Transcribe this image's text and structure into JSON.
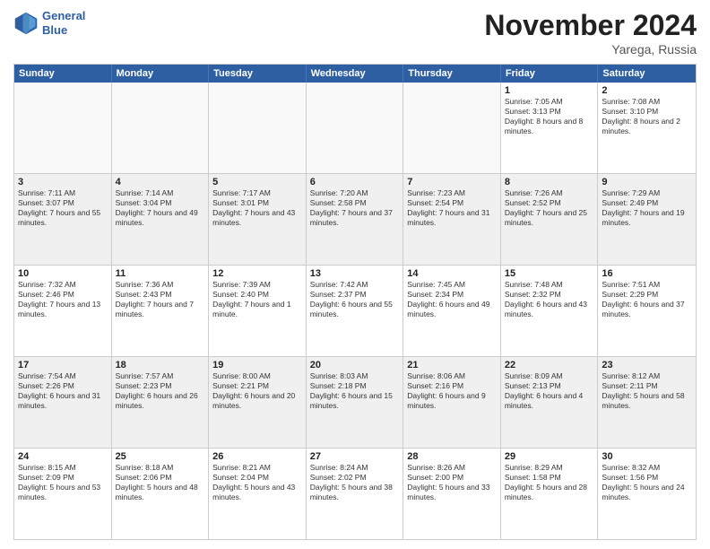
{
  "header": {
    "logo_line1": "General",
    "logo_line2": "Blue",
    "month_title": "November 2024",
    "location": "Yarega, Russia"
  },
  "days_of_week": [
    "Sunday",
    "Monday",
    "Tuesday",
    "Wednesday",
    "Thursday",
    "Friday",
    "Saturday"
  ],
  "weeks": [
    [
      {
        "day": "",
        "empty": true
      },
      {
        "day": "",
        "empty": true
      },
      {
        "day": "",
        "empty": true
      },
      {
        "day": "",
        "empty": true
      },
      {
        "day": "",
        "empty": true
      },
      {
        "day": "1",
        "sunrise": "Sunrise: 7:05 AM",
        "sunset": "Sunset: 3:13 PM",
        "daylight": "Daylight: 8 hours and 8 minutes."
      },
      {
        "day": "2",
        "sunrise": "Sunrise: 7:08 AM",
        "sunset": "Sunset: 3:10 PM",
        "daylight": "Daylight: 8 hours and 2 minutes."
      }
    ],
    [
      {
        "day": "3",
        "sunrise": "Sunrise: 7:11 AM",
        "sunset": "Sunset: 3:07 PM",
        "daylight": "Daylight: 7 hours and 55 minutes."
      },
      {
        "day": "4",
        "sunrise": "Sunrise: 7:14 AM",
        "sunset": "Sunset: 3:04 PM",
        "daylight": "Daylight: 7 hours and 49 minutes."
      },
      {
        "day": "5",
        "sunrise": "Sunrise: 7:17 AM",
        "sunset": "Sunset: 3:01 PM",
        "daylight": "Daylight: 7 hours and 43 minutes."
      },
      {
        "day": "6",
        "sunrise": "Sunrise: 7:20 AM",
        "sunset": "Sunset: 2:58 PM",
        "daylight": "Daylight: 7 hours and 37 minutes."
      },
      {
        "day": "7",
        "sunrise": "Sunrise: 7:23 AM",
        "sunset": "Sunset: 2:54 PM",
        "daylight": "Daylight: 7 hours and 31 minutes."
      },
      {
        "day": "8",
        "sunrise": "Sunrise: 7:26 AM",
        "sunset": "Sunset: 2:52 PM",
        "daylight": "Daylight: 7 hours and 25 minutes."
      },
      {
        "day": "9",
        "sunrise": "Sunrise: 7:29 AM",
        "sunset": "Sunset: 2:49 PM",
        "daylight": "Daylight: 7 hours and 19 minutes."
      }
    ],
    [
      {
        "day": "10",
        "sunrise": "Sunrise: 7:32 AM",
        "sunset": "Sunset: 2:46 PM",
        "daylight": "Daylight: 7 hours and 13 minutes."
      },
      {
        "day": "11",
        "sunrise": "Sunrise: 7:36 AM",
        "sunset": "Sunset: 2:43 PM",
        "daylight": "Daylight: 7 hours and 7 minutes."
      },
      {
        "day": "12",
        "sunrise": "Sunrise: 7:39 AM",
        "sunset": "Sunset: 2:40 PM",
        "daylight": "Daylight: 7 hours and 1 minute."
      },
      {
        "day": "13",
        "sunrise": "Sunrise: 7:42 AM",
        "sunset": "Sunset: 2:37 PM",
        "daylight": "Daylight: 6 hours and 55 minutes."
      },
      {
        "day": "14",
        "sunrise": "Sunrise: 7:45 AM",
        "sunset": "Sunset: 2:34 PM",
        "daylight": "Daylight: 6 hours and 49 minutes."
      },
      {
        "day": "15",
        "sunrise": "Sunrise: 7:48 AM",
        "sunset": "Sunset: 2:32 PM",
        "daylight": "Daylight: 6 hours and 43 minutes."
      },
      {
        "day": "16",
        "sunrise": "Sunrise: 7:51 AM",
        "sunset": "Sunset: 2:29 PM",
        "daylight": "Daylight: 6 hours and 37 minutes."
      }
    ],
    [
      {
        "day": "17",
        "sunrise": "Sunrise: 7:54 AM",
        "sunset": "Sunset: 2:26 PM",
        "daylight": "Daylight: 6 hours and 31 minutes."
      },
      {
        "day": "18",
        "sunrise": "Sunrise: 7:57 AM",
        "sunset": "Sunset: 2:23 PM",
        "daylight": "Daylight: 6 hours and 26 minutes."
      },
      {
        "day": "19",
        "sunrise": "Sunrise: 8:00 AM",
        "sunset": "Sunset: 2:21 PM",
        "daylight": "Daylight: 6 hours and 20 minutes."
      },
      {
        "day": "20",
        "sunrise": "Sunrise: 8:03 AM",
        "sunset": "Sunset: 2:18 PM",
        "daylight": "Daylight: 6 hours and 15 minutes."
      },
      {
        "day": "21",
        "sunrise": "Sunrise: 8:06 AM",
        "sunset": "Sunset: 2:16 PM",
        "daylight": "Daylight: 6 hours and 9 minutes."
      },
      {
        "day": "22",
        "sunrise": "Sunrise: 8:09 AM",
        "sunset": "Sunset: 2:13 PM",
        "daylight": "Daylight: 6 hours and 4 minutes."
      },
      {
        "day": "23",
        "sunrise": "Sunrise: 8:12 AM",
        "sunset": "Sunset: 2:11 PM",
        "daylight": "Daylight: 5 hours and 58 minutes."
      }
    ],
    [
      {
        "day": "24",
        "sunrise": "Sunrise: 8:15 AM",
        "sunset": "Sunset: 2:09 PM",
        "daylight": "Daylight: 5 hours and 53 minutes."
      },
      {
        "day": "25",
        "sunrise": "Sunrise: 8:18 AM",
        "sunset": "Sunset: 2:06 PM",
        "daylight": "Daylight: 5 hours and 48 minutes."
      },
      {
        "day": "26",
        "sunrise": "Sunrise: 8:21 AM",
        "sunset": "Sunset: 2:04 PM",
        "daylight": "Daylight: 5 hours and 43 minutes."
      },
      {
        "day": "27",
        "sunrise": "Sunrise: 8:24 AM",
        "sunset": "Sunset: 2:02 PM",
        "daylight": "Daylight: 5 hours and 38 minutes."
      },
      {
        "day": "28",
        "sunrise": "Sunrise: 8:26 AM",
        "sunset": "Sunset: 2:00 PM",
        "daylight": "Daylight: 5 hours and 33 minutes."
      },
      {
        "day": "29",
        "sunrise": "Sunrise: 8:29 AM",
        "sunset": "Sunset: 1:58 PM",
        "daylight": "Daylight: 5 hours and 28 minutes."
      },
      {
        "day": "30",
        "sunrise": "Sunrise: 8:32 AM",
        "sunset": "Sunset: 1:56 PM",
        "daylight": "Daylight: 5 hours and 24 minutes."
      }
    ]
  ]
}
